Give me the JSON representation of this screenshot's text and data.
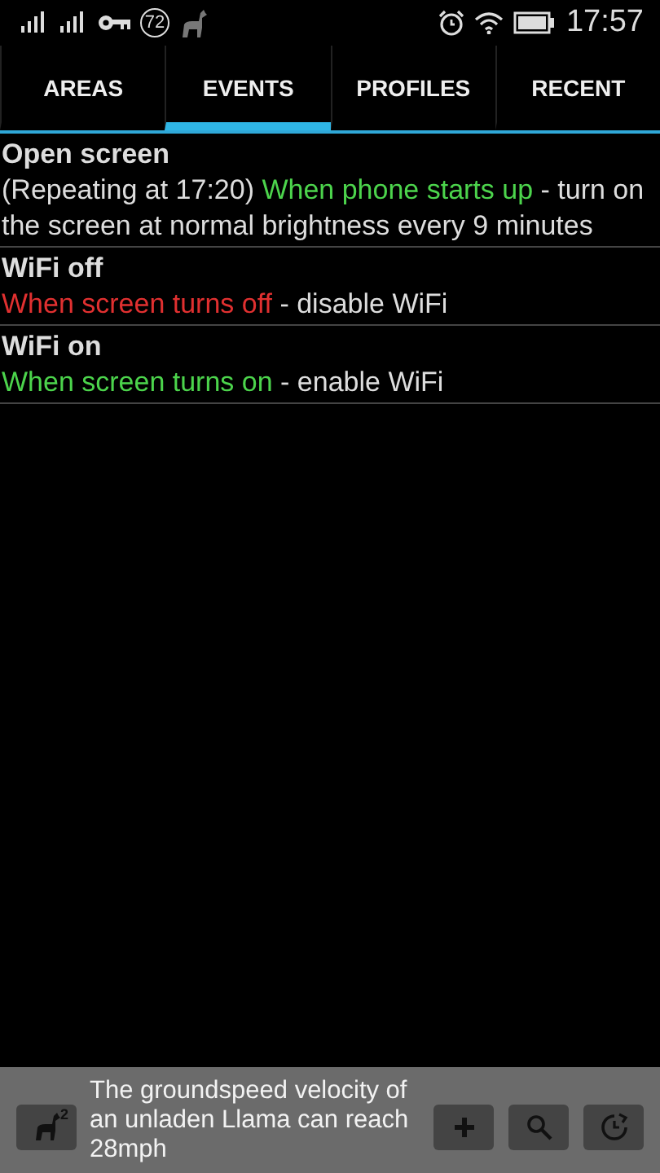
{
  "status_bar": {
    "notification_count": "72",
    "time": "17:57"
  },
  "tabs": [
    {
      "label": "AREAS",
      "selected": false
    },
    {
      "label": "EVENTS",
      "selected": true
    },
    {
      "label": "PROFILES",
      "selected": false
    },
    {
      "label": "RECENT",
      "selected": false
    }
  ],
  "events": [
    {
      "title": "Open screen",
      "description": [
        {
          "kind": "plain",
          "text": "(Repeating at 17:20) "
        },
        {
          "kind": "trigger",
          "color": "#4cd44c",
          "text": "When phone starts up"
        },
        {
          "kind": "plain",
          "text": " - turn on the screen at normal brightness every 9 minutes"
        }
      ]
    },
    {
      "title": "WiFi off",
      "description": [
        {
          "kind": "trigger",
          "color": "#e03030",
          "text": "When screen turns off"
        },
        {
          "kind": "plain",
          "text": " - disable WiFi"
        }
      ]
    },
    {
      "title": "WiFi on",
      "description": [
        {
          "kind": "trigger",
          "color": "#4cd44c",
          "text": "When screen turns on"
        },
        {
          "kind": "plain",
          "text": " - enable WiFi"
        }
      ]
    }
  ],
  "bottom_bar": {
    "llama_badge": "2",
    "message": "The groundspeed velocity of an unladen Llama can reach 28mph"
  }
}
